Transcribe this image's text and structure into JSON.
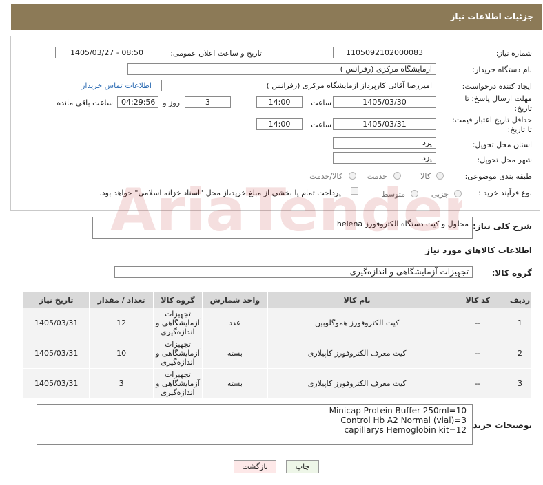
{
  "header": {
    "title": "جزئیات اطلاعات نیاز"
  },
  "form": {
    "need_number_label": "شماره نیاز:",
    "need_number": "1105092102000083",
    "announce_label": "تاریخ و ساعت اعلان عمومی:",
    "announce_value": "1405/03/27 - 08:50",
    "buyer_label": "نام دستگاه خریدار:",
    "buyer_value": "ازمایشگاه مرکزی (رفرانس )",
    "creator_label": "ایجاد کننده درخواست:",
    "creator_value": "امیررضا آقائی کارپرداز ازمایشگاه مرکزی (رفرانس )",
    "contact_link": "اطلاعات تماس خریدار",
    "deadline_label_1": "مهلت ارسال پاسخ: تا",
    "deadline_label_2": "تاریخ:",
    "deadline_date": "1405/03/30",
    "time_label": "ساعت",
    "deadline_time": "14:00",
    "days_value": "3",
    "days_label": "روز و",
    "remaining_value": "04:29:56",
    "remaining_label": "ساعت باقی مانده",
    "validity_label_1": "حداقل تاریخ اعتبار قیمت:",
    "validity_label_2": "تا تاریخ:",
    "validity_date": "1405/03/31",
    "validity_time": "14:00",
    "province_label": "استان محل تحویل:",
    "province_value": "یزد",
    "city_label": "شهر محل تحویل:",
    "city_value": "یزد",
    "category_label": "طبقه بندی موضوعی:",
    "category_options": [
      "کالا",
      "خدمت",
      "کالا/خدمت"
    ],
    "process_label": "نوع فرآیند خرید :",
    "process_options": [
      "جزیی",
      "متوسط"
    ],
    "payment_note": "پرداخت تمام یا بخشی از مبلغ خرید،از محل \"اسناد خزانه اسلامی\" خواهد بود."
  },
  "summary": {
    "label": "شرح کلی نیاز:",
    "value": "محلول و کیت دستگاه الکتروفورز helena"
  },
  "goods": {
    "section_title": "اطلاعات کالاهای مورد نیاز",
    "group_label": "گروه کالا:",
    "group_value": "تجهیزات آزمایشگاهی و اندازه‌گیری",
    "columns": [
      "ردیف",
      "کد کالا",
      "نام کالا",
      "واحد شمارش",
      "گروه کالا",
      "تعداد / مقدار",
      "تاریخ نیاز"
    ],
    "rows": [
      {
        "idx": "1",
        "code": "--",
        "name": "کیت الکتروفورز هموگلوبین",
        "unit": "عدد",
        "group": "تجهیزات آزمایشگاهی و اندازه‌گیری",
        "qty": "12",
        "date": "1405/03/31"
      },
      {
        "idx": "2",
        "code": "--",
        "name": "کیت معرف الکتروفورز کاپیلاری",
        "unit": "بسته",
        "group": "تجهیزات آزمایشگاهی و اندازه‌گیری",
        "qty": "10",
        "date": "1405/03/31"
      },
      {
        "idx": "3",
        "code": "--",
        "name": "کیت معرف الکتروفورز کاپیلاری",
        "unit": "بسته",
        "group": "تجهیزات آزمایشگاهی و اندازه‌گیری",
        "qty": "3",
        "date": "1405/03/31"
      }
    ]
  },
  "buyer_notes": {
    "label": "توضیحات خریدار:",
    "lines": [
      "Minicap Protein Buffer 250ml=10",
      "Control Hb A2 Normal (vial)=3",
      "capillarys Hemoglobin  kit=12"
    ]
  },
  "buttons": {
    "print": "چاپ",
    "back": "بازگشت"
  },
  "watermark": {
    "text": "AriaTender.net"
  }
}
